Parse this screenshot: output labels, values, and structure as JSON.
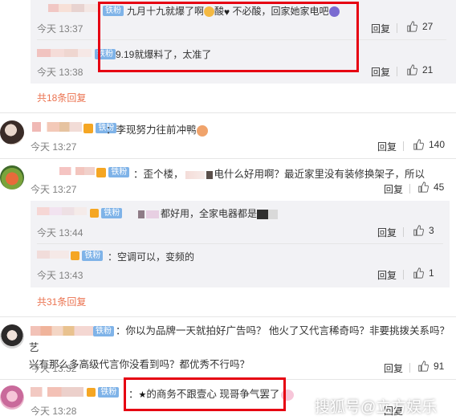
{
  "reply_label": "回复",
  "thread1": {
    "replies": [
      {
        "text": "九月十九就爆了啊",
        "text_b": "酸",
        "text_c": "不必酸，回家她家电吧",
        "badge": "铁粉",
        "time": "今天 13:37",
        "likes": "27"
      },
      {
        "text": "9.19就爆料了，太准了",
        "badge": "铁粉",
        "time": "今天 13:38",
        "likes": "21"
      }
    ],
    "more_replies": "共18条回复"
  },
  "comment_li": {
    "badge": "铁粉",
    "text": "：李现努力往前冲鸭",
    "time": "今天 13:27",
    "likes": "140"
  },
  "comment_weilou": {
    "badge": "铁粉",
    "text_a": "：歪个楼，",
    "text_b": "电什么好用啊？最近家里没有装修换架子，所以",
    "time": "今天 13:27",
    "likes": "45",
    "replies": [
      {
        "badge": "铁粉",
        "text_a": "都好用，全家电器都是",
        "time": "今天 13:44",
        "likes": "3"
      },
      {
        "badge": "铁粉",
        "text": "：空调可以，变频的",
        "time": "今天 13:43",
        "likes": "1"
      }
    ],
    "more_replies": "共31条回复"
  },
  "comment_ad": {
    "badge": "铁粉",
    "line1": "：你以为品牌一天就拍好广告吗？ 他火了又代言稀奇吗？非要挑拨关系吗？艺",
    "line2": "兴有那么多高级代言你没看到吗？都优秀不行吗？",
    "time": "今天 13:32",
    "likes": "91"
  },
  "comment_last": {
    "badge": "铁粉",
    "text": "：",
    "text_b": "的商务不跟壹心 现哥争气罢了",
    "time": "今天 13:28"
  },
  "watermark": "搜狐号@立方娱乐",
  "colors": {
    "highlight_box": "#e60012",
    "more_link": "#eb7350",
    "badge_bg": "#7fb3e8",
    "reply_bg": "#f2f2f5"
  }
}
